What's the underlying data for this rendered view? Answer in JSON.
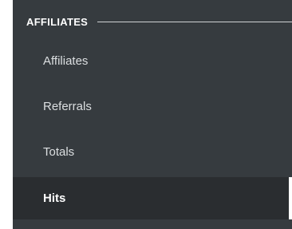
{
  "sidebar": {
    "section_title": "AFFILIATES",
    "items": [
      {
        "label": "Affiliates",
        "active": false
      },
      {
        "label": "Referrals",
        "active": false
      },
      {
        "label": "Totals",
        "active": false
      },
      {
        "label": "Hits",
        "active": true
      }
    ]
  },
  "colors": {
    "sidebar_background": "#363b3f",
    "active_background": "#2a2d30",
    "text": "#dcdfe1",
    "heading": "#ffffff"
  }
}
